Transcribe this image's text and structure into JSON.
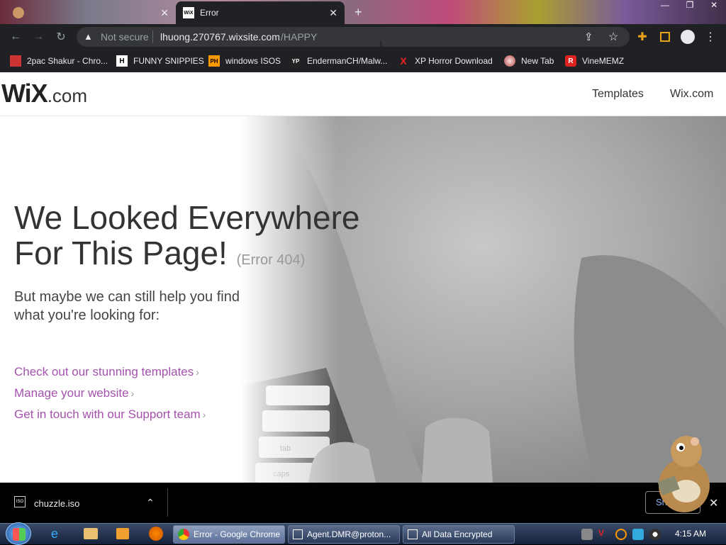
{
  "browser": {
    "tabs": [
      {
        "title": "",
        "active": false
      },
      {
        "title": "Error",
        "active": true
      }
    ],
    "new_tab_symbol": "+",
    "address": {
      "security_label": "Not secure",
      "domain": "lhuong.270767.wixsite.com",
      "path": "/HAPPY"
    },
    "bookmarks": [
      {
        "label": "2pac Shakur - Chro...",
        "icon": "calendar-icon",
        "icon_text": ""
      },
      {
        "label": "FUNNY SNIPPIES",
        "icon": "h-icon",
        "icon_text": "H"
      },
      {
        "label": "windows ISOS",
        "icon": "ph-icon",
        "icon_text": "PH"
      },
      {
        "label": "EndermanCH/Malw...",
        "icon": "yp-icon",
        "icon_text": "YP"
      },
      {
        "label": "XP Horror Download",
        "icon": "x-icon",
        "icon_text": "X"
      },
      {
        "label": "New Tab",
        "icon": "globe-icon",
        "icon_text": ""
      },
      {
        "label": "VineMEMZ",
        "icon": "r-icon",
        "icon_text": "R"
      }
    ]
  },
  "page": {
    "logo_main": "WiX",
    "logo_suffix": ".com",
    "nav": [
      {
        "label": "Templates"
      },
      {
        "label": "Wix.com"
      }
    ],
    "title_line1": "We Looked Everywhere",
    "title_line2": "For This Page!",
    "error_code": "(Error 404)",
    "subtitle_line1": "But maybe we can still help you find",
    "subtitle_line2": "what you're looking for:",
    "links": [
      {
        "label": "Check out our stunning templates"
      },
      {
        "label": "Manage your website"
      },
      {
        "label": "Get in touch with our Support team"
      }
    ],
    "keyboard_keys": [
      "tab",
      "caps"
    ],
    "link_color": "#a451ad"
  },
  "downloads": {
    "file": "chuzzle.iso",
    "file_icon_text": "ISO",
    "button_label": "Sh"
  },
  "taskbar": {
    "tasks": [
      {
        "label": "Error - Google Chrome",
        "active": true
      },
      {
        "label": "Agent.DMR@proton...",
        "active": false
      },
      {
        "label": "All Data Encrypted",
        "active": false
      }
    ],
    "clock": "4:15 AM"
  }
}
